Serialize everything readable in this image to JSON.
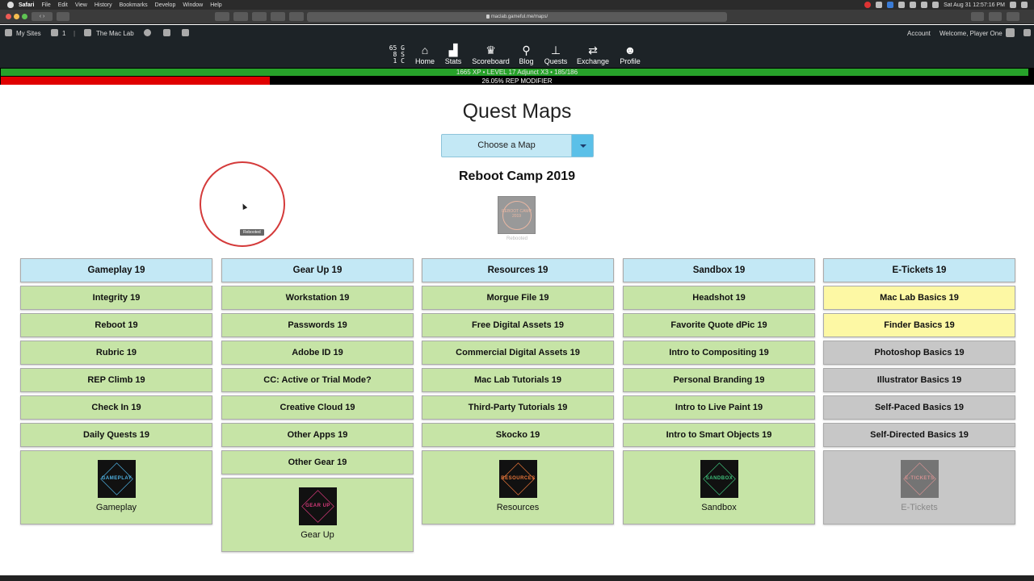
{
  "mac_menu": {
    "app": "Safari",
    "items": [
      "File",
      "Edit",
      "View",
      "History",
      "Bookmarks",
      "Develop",
      "Window",
      "Help"
    ],
    "clock": "Sat Aug 31  12:57:16 PM"
  },
  "browser": {
    "url": "maclab.gameful.me/maps/"
  },
  "admin_bar": {
    "my_sites": "My Sites",
    "comments": "1",
    "site_name": "The Mac Lab",
    "account": "Account",
    "welcome": "Welcome, Player One"
  },
  "currency": {
    "gold": "65 G",
    "silver": "8 S",
    "copper": "1 C"
  },
  "nav": [
    {
      "label": "Home",
      "icon": "home-icon",
      "glyph": "⌂"
    },
    {
      "label": "Stats",
      "icon": "stats-chart-icon",
      "glyph": "▟"
    },
    {
      "label": "Scoreboard",
      "icon": "trophy-icon",
      "glyph": "♛"
    },
    {
      "label": "Blog",
      "icon": "pushpin-icon",
      "glyph": "⚲"
    },
    {
      "label": "Quests",
      "icon": "sitemap-icon",
      "glyph": "⊥"
    },
    {
      "label": "Exchange",
      "icon": "exchange-arrows-icon",
      "glyph": "⇄"
    },
    {
      "label": "Profile",
      "icon": "profile-avatar-icon",
      "glyph": "☻"
    }
  ],
  "xp_bar": {
    "text": "1665 XP   •   LEVEL 17 Adjunct X3   •   185/186",
    "progress": 0.995
  },
  "rep_bar": {
    "text": "26.05% REP MODIFIER",
    "progress": 0.2605
  },
  "page": {
    "title": "Quest Maps",
    "select_label": "Choose a Map",
    "map_name": "Reboot Camp 2019",
    "badge_caption": "Rebooted",
    "badge_text": "REBOOT CAMP 2019",
    "tooltip": "Rebooted"
  },
  "columns": [
    {
      "header": "Gameplay 19",
      "quests": [
        {
          "label": "Integrity 19",
          "state": "green"
        },
        {
          "label": "Reboot 19",
          "state": "green"
        },
        {
          "label": "Rubric 19",
          "state": "green"
        },
        {
          "label": "REP Climb 19",
          "state": "green"
        },
        {
          "label": "Check In 19",
          "state": "green"
        },
        {
          "label": "Daily Quests 19",
          "state": "green"
        }
      ],
      "card": {
        "caption": "Gameplay",
        "logo_word": "GAMEPLAY",
        "logo_color": "#4fb0e0",
        "state": "green"
      }
    },
    {
      "header": "Gear Up 19",
      "quests": [
        {
          "label": "Workstation 19",
          "state": "green"
        },
        {
          "label": "Passwords 19",
          "state": "green"
        },
        {
          "label": "Adobe ID 19",
          "state": "green"
        },
        {
          "label": "CC: Active or Trial Mode?",
          "state": "green"
        },
        {
          "label": "Creative Cloud 19",
          "state": "green"
        },
        {
          "label": "Other Apps 19",
          "state": "green"
        },
        {
          "label": "Other Gear 19",
          "state": "green"
        }
      ],
      "card": {
        "caption": "Gear Up",
        "logo_word": "GEAR UP",
        "logo_color": "#d63a7a",
        "state": "green"
      }
    },
    {
      "header": "Resources 19",
      "quests": [
        {
          "label": "Morgue File 19",
          "state": "green"
        },
        {
          "label": "Free Digital Assets 19",
          "state": "green"
        },
        {
          "label": "Commercial Digital Assets 19",
          "state": "green"
        },
        {
          "label": "Mac Lab Tutorials 19",
          "state": "green"
        },
        {
          "label": "Third-Party Tutorials 19",
          "state": "green"
        },
        {
          "label": "Skocko 19",
          "state": "green"
        }
      ],
      "card": {
        "caption": "Resources",
        "logo_word": "RESOURCES",
        "logo_color": "#e8763a",
        "state": "green"
      }
    },
    {
      "header": "Sandbox 19",
      "quests": [
        {
          "label": "Headshot 19",
          "state": "green"
        },
        {
          "label": "Favorite Quote dPic 19",
          "state": "green"
        },
        {
          "label": "Intro to Compositing 19",
          "state": "green"
        },
        {
          "label": "Personal Branding 19",
          "state": "green"
        },
        {
          "label": "Intro to Live Paint 19",
          "state": "green"
        },
        {
          "label": "Intro to Smart Objects 19",
          "state": "green"
        }
      ],
      "card": {
        "caption": "Sandbox",
        "logo_word": "SANDBOX",
        "logo_color": "#3ec07a",
        "state": "green"
      }
    },
    {
      "header": "E-Tickets 19",
      "quests": [
        {
          "label": "Mac Lab Basics 19",
          "state": "yellow"
        },
        {
          "label": "Finder Basics 19",
          "state": "yellow"
        },
        {
          "label": "Photoshop Basics 19",
          "state": "gray"
        },
        {
          "label": "Illustrator Basics 19",
          "state": "gray"
        },
        {
          "label": "Self-Paced Basics 19",
          "state": "gray"
        },
        {
          "label": "Self-Directed Basics 19",
          "state": "gray"
        }
      ],
      "card": {
        "caption": "E-Tickets",
        "logo_word": "E-TICKETS",
        "logo_color": "#e05050",
        "state": "gray"
      }
    }
  ]
}
